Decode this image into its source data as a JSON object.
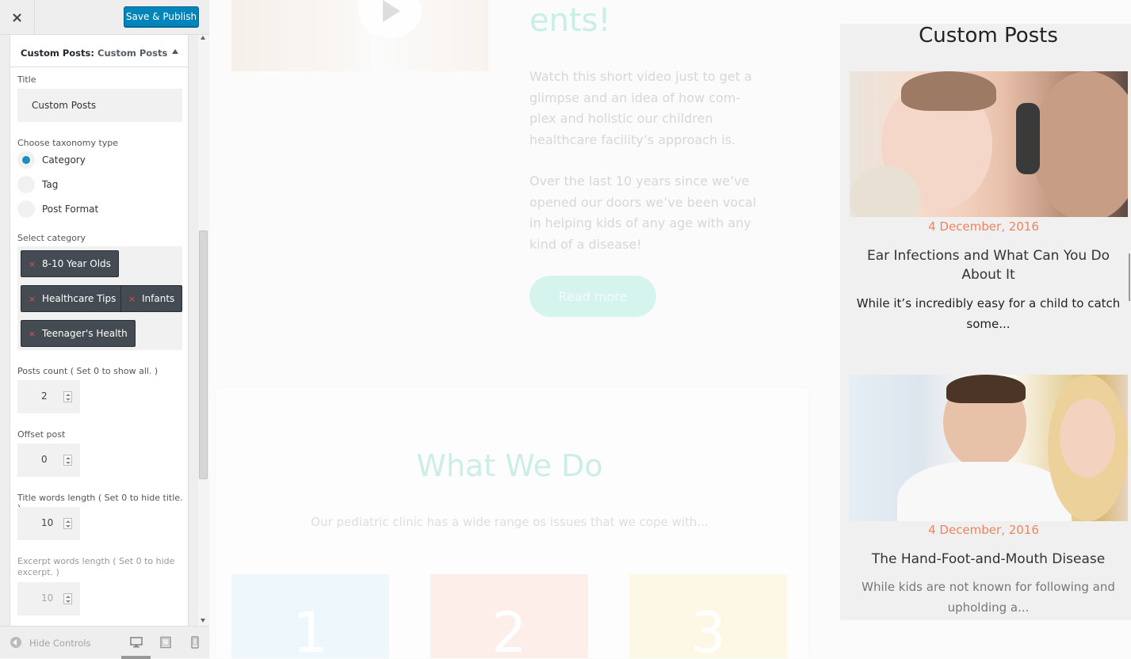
{
  "sidebar": {
    "close_icon": "×",
    "publish_label": "Save & Publish",
    "section": {
      "prefix": "Custom Posts:",
      "name": "Custom Posts"
    },
    "title_label": "Title",
    "title_value": "Custom Posts",
    "taxonomy_label": "Choose taxonomy type",
    "taxonomy_options": [
      "Category",
      "Tag",
      "Post Format"
    ],
    "taxonomy_selected": "Category",
    "category_label": "Select category",
    "categories": [
      "8-10 Year Olds",
      "Healthcare Tips",
      "Infants",
      "Teenager's Health"
    ],
    "remove_icon": "×",
    "posts_count_label": "Posts count ( Set 0 to show all. )",
    "posts_count": "2",
    "offset_label": "Offset post",
    "offset": "0",
    "title_len_label": "Title words length ( Set 0 to hide title. )",
    "title_len": "10",
    "excerpt_len_label": "Excerpt words length ( Set 0 to hide excerpt. )",
    "excerpt_len": "10",
    "hide_controls": "Hide Controls"
  },
  "preview": {
    "hero_title": "ents!",
    "hero_p1": "Watch this short video just to get a glimpse and an idea of how com-plex and holistic our children healthcare facility’s approach is.",
    "hero_p2": "Over the last 10 years since we’ve opened our doors we’ve been vocal in helping kids of any age with any kind of a disease!",
    "read_more": "Read more",
    "what_title": "What We Do",
    "what_sub": "Our pediatric clinic has a wide range os issues that we cope with...",
    "cards": [
      "1",
      "2",
      "3"
    ],
    "card_colors": [
      "#e9f6fb",
      "#fce9e5",
      "#fdf6de"
    ],
    "accent": "#c7efe8",
    "date_color": "#f0845e"
  },
  "widget": {
    "title": "Custom Posts",
    "posts": [
      {
        "date": "4 December, 2016",
        "title": "Ear Infections and What Can You Do About It",
        "excerpt": "While it’s incredibly easy for a child to catch some..."
      },
      {
        "date": "4 December, 2016",
        "title": "The Hand-Foot-and-Mouth Disease",
        "excerpt": "While kids are not known for following and upholding a..."
      }
    ]
  }
}
